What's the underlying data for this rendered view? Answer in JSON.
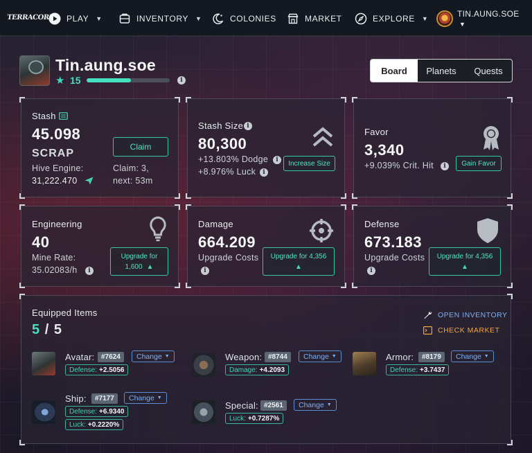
{
  "nav": {
    "logo": "TERRACORE",
    "items": [
      {
        "label": "PLAY",
        "icon": "play-icon",
        "has_caret": true
      },
      {
        "label": "INVENTORY",
        "icon": "inventory-icon",
        "has_caret": true
      },
      {
        "label": "COLONIES",
        "icon": "colonies-icon",
        "has_caret": false
      },
      {
        "label": "MARKET",
        "icon": "market-icon",
        "has_caret": false
      },
      {
        "label": "EXPLORE",
        "icon": "compass-icon",
        "has_caret": true
      }
    ],
    "profile_name": "TIN.AUNG.SOE"
  },
  "header": {
    "username": "Tin.aung.soe",
    "level": "15",
    "xp_progress": 0.53,
    "tabs": [
      "Board",
      "Planets",
      "Quests"
    ],
    "active_tab": "Board"
  },
  "stash": {
    "label": "Stash",
    "value": "45.098",
    "unit": "SCRAP",
    "hive_label": "Hive Engine:",
    "hive_value": "31,222.470",
    "claim_button": "Claim",
    "claim_info": "Claim: 3,",
    "claim_next": "next: 53m"
  },
  "stash_size": {
    "label": "Stash Size",
    "value": "80,300",
    "dodge": "+13.803% Dodge",
    "luck": "+8.976% Luck",
    "button": "Increase Size"
  },
  "favor": {
    "label": "Favor",
    "value": "3,340",
    "crit": "+9.039% Crit. Hit",
    "button": "Gain Favor"
  },
  "engineering": {
    "label": "Engineering",
    "value": "40",
    "rate_label": "Mine Rate:",
    "rate_value": "35.02083/h",
    "button_line1": "Upgrade for",
    "button_line2": "1,600"
  },
  "damage": {
    "label": "Damage",
    "value": "664.209",
    "costs_label": "Upgrade Costs",
    "button_line1": "Upgrade for 4,356"
  },
  "defense": {
    "label": "Defense",
    "value": "673.183",
    "costs_label": "Upgrade Costs",
    "button_line1": "Upgrade for 4,356"
  },
  "equipped": {
    "title": "Equipped Items",
    "count": "5",
    "total": "5",
    "open_inventory": "OPEN INVENTORY",
    "check_market": "CHECK MARKET",
    "change_label": "Change",
    "items": [
      {
        "slot": "Avatar:",
        "id": "#7624",
        "stats": [
          {
            "k": "Defense:",
            "v": "+2.5056"
          }
        ]
      },
      {
        "slot": "Weapon:",
        "id": "#8744",
        "stats": [
          {
            "k": "Damage:",
            "v": "+4.2093"
          }
        ]
      },
      {
        "slot": "Armor:",
        "id": "#8179",
        "stats": [
          {
            "k": "Defense:",
            "v": "+3.7437"
          }
        ]
      },
      {
        "slot": "Ship:",
        "id": "#7177",
        "stats": [
          {
            "k": "Defense:",
            "v": "+6.9340"
          },
          {
            "k": "Luck:",
            "v": "+0.2220%"
          }
        ]
      },
      {
        "slot": "Special:",
        "id": "#2561",
        "stats": [
          {
            "k": "Luck:",
            "v": "+0.7287%"
          }
        ]
      }
    ]
  },
  "colors": {
    "accent": "#46e0c0",
    "link_blue": "#7fb1f1",
    "link_orange": "#f0a640",
    "nav_bg": "#141821"
  }
}
